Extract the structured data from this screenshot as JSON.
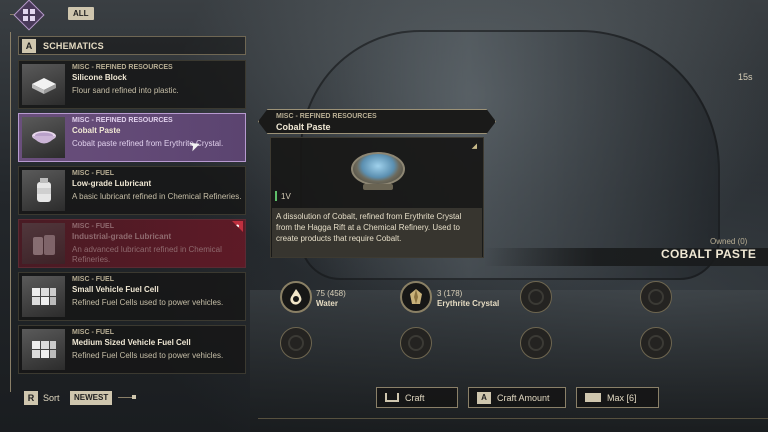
{
  "filter": {
    "all_label": "ALL",
    "icon": "grid-icon"
  },
  "schematics": {
    "key": "A",
    "title": "SCHEMATICS"
  },
  "items": [
    {
      "category": "MISC - REFINED RESOURCES",
      "name": "Silicone Block",
      "desc": "Flour sand refined into plastic.",
      "state": "normal"
    },
    {
      "category": "MISC - REFINED RESOURCES",
      "name": "Cobalt Paste",
      "desc": "Cobalt paste refined from Erythrite Crystal.",
      "state": "selected"
    },
    {
      "category": "MISC - FUEL",
      "name": "Low-grade Lubricant",
      "desc": "A basic lubricant refined in Chemical Refineries.",
      "state": "normal"
    },
    {
      "category": "MISC - FUEL",
      "name": "Industrial-grade Lubricant",
      "desc": "An advanced lubricant refined in Chemical Refineries.",
      "state": "locked"
    },
    {
      "category": "MISC - FUEL",
      "name": "Small Vehicle Fuel Cell",
      "desc": "Refined Fuel Cells used to power vehicles.",
      "state": "normal"
    },
    {
      "category": "MISC - FUEL",
      "name": "Medium Sized Vehicle Fuel Cell",
      "desc": "Refined Fuel Cells used to power vehicles.",
      "state": "normal"
    }
  ],
  "sort": {
    "key": "R",
    "label": "Sort",
    "value": "NEWEST"
  },
  "tooltip": {
    "category": "MISC - REFINED RESOURCES",
    "name": "Cobalt Paste",
    "durability": "1V",
    "description": "A dissolution of Cobalt, refined from Erythrite Crystal from the Hagga Rift at a Chemical Refinery. Used to create products that require Cobalt."
  },
  "timer": "15s",
  "product": {
    "owned": "Owned (0)",
    "name": "COBALT PASTE"
  },
  "ingredients": [
    {
      "qty": "75 (458)",
      "name": "Water",
      "icon": "water-drop-icon"
    },
    {
      "qty": "3 (178)",
      "name": "Erythrite Crystal",
      "icon": "crystal-icon"
    }
  ],
  "buttons": {
    "craft": {
      "label": "Craft"
    },
    "craft_amount": {
      "key": "A",
      "label": "Craft Amount"
    },
    "max": {
      "label": "Max [6]"
    }
  },
  "colors": {
    "accent": "#b79ad0",
    "locked": "#c0303f",
    "key": "#cfc6ae"
  }
}
